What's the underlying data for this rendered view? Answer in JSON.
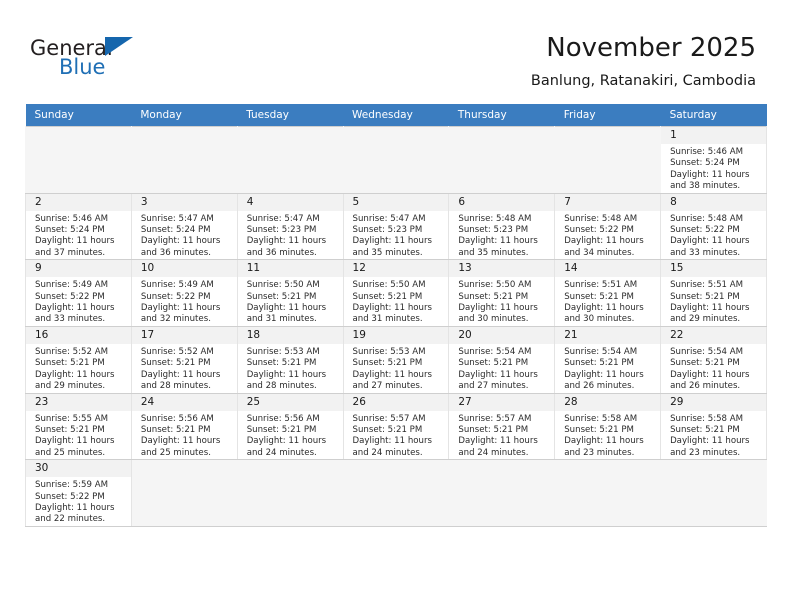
{
  "brand": {
    "name_part1": "General",
    "name_part2": "Blue",
    "flag_icon": "triangle-flag-icon",
    "accent_color": "#1566ad"
  },
  "header": {
    "title": "November 2025",
    "subtitle": "Banlung, Ratanakiri, Cambodia"
  },
  "calendar": {
    "header_bg": "#3b7dc0",
    "weekday_headers": [
      "Sunday",
      "Monday",
      "Tuesday",
      "Wednesday",
      "Thursday",
      "Friday",
      "Saturday"
    ],
    "weeks": [
      [
        {
          "empty": true
        },
        {
          "empty": true
        },
        {
          "empty": true
        },
        {
          "empty": true
        },
        {
          "empty": true
        },
        {
          "empty": true
        },
        {
          "day": "1",
          "sunrise": "Sunrise: 5:46 AM",
          "sunset": "Sunset: 5:24 PM",
          "daylight_line1": "Daylight: 11 hours",
          "daylight_line2": "and 38 minutes."
        }
      ],
      [
        {
          "day": "2",
          "sunrise": "Sunrise: 5:46 AM",
          "sunset": "Sunset: 5:24 PM",
          "daylight_line1": "Daylight: 11 hours",
          "daylight_line2": "and 37 minutes."
        },
        {
          "day": "3",
          "sunrise": "Sunrise: 5:47 AM",
          "sunset": "Sunset: 5:24 PM",
          "daylight_line1": "Daylight: 11 hours",
          "daylight_line2": "and 36 minutes."
        },
        {
          "day": "4",
          "sunrise": "Sunrise: 5:47 AM",
          "sunset": "Sunset: 5:23 PM",
          "daylight_line1": "Daylight: 11 hours",
          "daylight_line2": "and 36 minutes."
        },
        {
          "day": "5",
          "sunrise": "Sunrise: 5:47 AM",
          "sunset": "Sunset: 5:23 PM",
          "daylight_line1": "Daylight: 11 hours",
          "daylight_line2": "and 35 minutes."
        },
        {
          "day": "6",
          "sunrise": "Sunrise: 5:48 AM",
          "sunset": "Sunset: 5:23 PM",
          "daylight_line1": "Daylight: 11 hours",
          "daylight_line2": "and 35 minutes."
        },
        {
          "day": "7",
          "sunrise": "Sunrise: 5:48 AM",
          "sunset": "Sunset: 5:22 PM",
          "daylight_line1": "Daylight: 11 hours",
          "daylight_line2": "and 34 minutes."
        },
        {
          "day": "8",
          "sunrise": "Sunrise: 5:48 AM",
          "sunset": "Sunset: 5:22 PM",
          "daylight_line1": "Daylight: 11 hours",
          "daylight_line2": "and 33 minutes."
        }
      ],
      [
        {
          "day": "9",
          "sunrise": "Sunrise: 5:49 AM",
          "sunset": "Sunset: 5:22 PM",
          "daylight_line1": "Daylight: 11 hours",
          "daylight_line2": "and 33 minutes."
        },
        {
          "day": "10",
          "sunrise": "Sunrise: 5:49 AM",
          "sunset": "Sunset: 5:22 PM",
          "daylight_line1": "Daylight: 11 hours",
          "daylight_line2": "and 32 minutes."
        },
        {
          "day": "11",
          "sunrise": "Sunrise: 5:50 AM",
          "sunset": "Sunset: 5:21 PM",
          "daylight_line1": "Daylight: 11 hours",
          "daylight_line2": "and 31 minutes."
        },
        {
          "day": "12",
          "sunrise": "Sunrise: 5:50 AM",
          "sunset": "Sunset: 5:21 PM",
          "daylight_line1": "Daylight: 11 hours",
          "daylight_line2": "and 31 minutes."
        },
        {
          "day": "13",
          "sunrise": "Sunrise: 5:50 AM",
          "sunset": "Sunset: 5:21 PM",
          "daylight_line1": "Daylight: 11 hours",
          "daylight_line2": "and 30 minutes."
        },
        {
          "day": "14",
          "sunrise": "Sunrise: 5:51 AM",
          "sunset": "Sunset: 5:21 PM",
          "daylight_line1": "Daylight: 11 hours",
          "daylight_line2": "and 30 minutes."
        },
        {
          "day": "15",
          "sunrise": "Sunrise: 5:51 AM",
          "sunset": "Sunset: 5:21 PM",
          "daylight_line1": "Daylight: 11 hours",
          "daylight_line2": "and 29 minutes."
        }
      ],
      [
        {
          "day": "16",
          "sunrise": "Sunrise: 5:52 AM",
          "sunset": "Sunset: 5:21 PM",
          "daylight_line1": "Daylight: 11 hours",
          "daylight_line2": "and 29 minutes."
        },
        {
          "day": "17",
          "sunrise": "Sunrise: 5:52 AM",
          "sunset": "Sunset: 5:21 PM",
          "daylight_line1": "Daylight: 11 hours",
          "daylight_line2": "and 28 minutes."
        },
        {
          "day": "18",
          "sunrise": "Sunrise: 5:53 AM",
          "sunset": "Sunset: 5:21 PM",
          "daylight_line1": "Daylight: 11 hours",
          "daylight_line2": "and 28 minutes."
        },
        {
          "day": "19",
          "sunrise": "Sunrise: 5:53 AM",
          "sunset": "Sunset: 5:21 PM",
          "daylight_line1": "Daylight: 11 hours",
          "daylight_line2": "and 27 minutes."
        },
        {
          "day": "20",
          "sunrise": "Sunrise: 5:54 AM",
          "sunset": "Sunset: 5:21 PM",
          "daylight_line1": "Daylight: 11 hours",
          "daylight_line2": "and 27 minutes."
        },
        {
          "day": "21",
          "sunrise": "Sunrise: 5:54 AM",
          "sunset": "Sunset: 5:21 PM",
          "daylight_line1": "Daylight: 11 hours",
          "daylight_line2": "and 26 minutes."
        },
        {
          "day": "22",
          "sunrise": "Sunrise: 5:54 AM",
          "sunset": "Sunset: 5:21 PM",
          "daylight_line1": "Daylight: 11 hours",
          "daylight_line2": "and 26 minutes."
        }
      ],
      [
        {
          "day": "23",
          "sunrise": "Sunrise: 5:55 AM",
          "sunset": "Sunset: 5:21 PM",
          "daylight_line1": "Daylight: 11 hours",
          "daylight_line2": "and 25 minutes."
        },
        {
          "day": "24",
          "sunrise": "Sunrise: 5:56 AM",
          "sunset": "Sunset: 5:21 PM",
          "daylight_line1": "Daylight: 11 hours",
          "daylight_line2": "and 25 minutes."
        },
        {
          "day": "25",
          "sunrise": "Sunrise: 5:56 AM",
          "sunset": "Sunset: 5:21 PM",
          "daylight_line1": "Daylight: 11 hours",
          "daylight_line2": "and 24 minutes."
        },
        {
          "day": "26",
          "sunrise": "Sunrise: 5:57 AM",
          "sunset": "Sunset: 5:21 PM",
          "daylight_line1": "Daylight: 11 hours",
          "daylight_line2": "and 24 minutes."
        },
        {
          "day": "27",
          "sunrise": "Sunrise: 5:57 AM",
          "sunset": "Sunset: 5:21 PM",
          "daylight_line1": "Daylight: 11 hours",
          "daylight_line2": "and 24 minutes."
        },
        {
          "day": "28",
          "sunrise": "Sunrise: 5:58 AM",
          "sunset": "Sunset: 5:21 PM",
          "daylight_line1": "Daylight: 11 hours",
          "daylight_line2": "and 23 minutes."
        },
        {
          "day": "29",
          "sunrise": "Sunrise: 5:58 AM",
          "sunset": "Sunset: 5:21 PM",
          "daylight_line1": "Daylight: 11 hours",
          "daylight_line2": "and 23 minutes."
        }
      ],
      [
        {
          "day": "30",
          "sunrise": "Sunrise: 5:59 AM",
          "sunset": "Sunset: 5:22 PM",
          "daylight_line1": "Daylight: 11 hours",
          "daylight_line2": "and 22 minutes."
        },
        {
          "empty": true
        },
        {
          "empty": true
        },
        {
          "empty": true
        },
        {
          "empty": true
        },
        {
          "empty": true
        },
        {
          "empty": true
        }
      ]
    ]
  }
}
